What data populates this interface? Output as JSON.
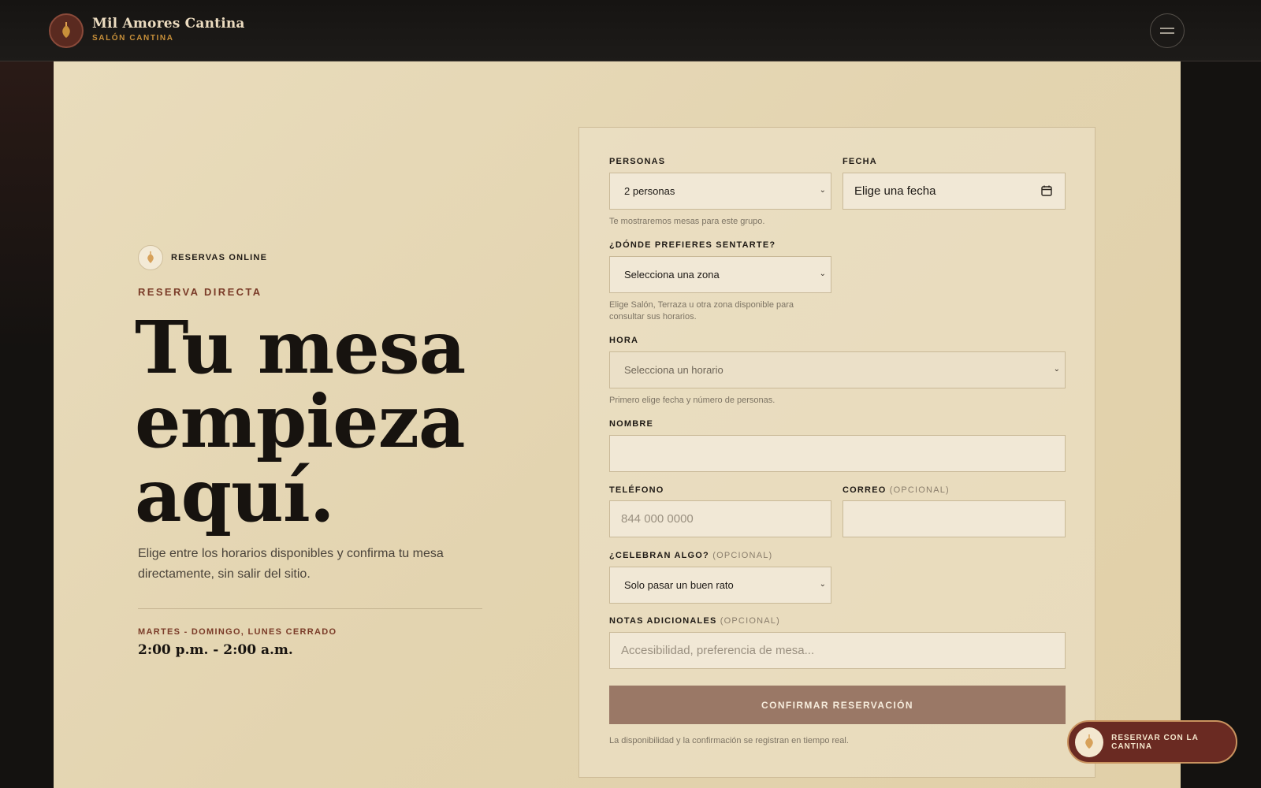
{
  "header": {
    "brand_name": "Mil Amores Cantina",
    "brand_sub": "SALÓN CANTINA",
    "logo_icon": "sacred-heart-icon",
    "menu_icon": "hamburger-menu-icon"
  },
  "hero": {
    "badge_text": "RESERVAS ONLINE",
    "eyebrow": "RESERVA DIRECTA",
    "title_lines": [
      "Tu mesa",
      "empieza",
      "aquí."
    ],
    "description": "Elige entre los horarios disponibles y confirma tu mesa directamente, sin salir del sitio.",
    "hours_label": "MARTES - DOMINGO, LUNES CERRADO",
    "hours_value": "2:00 p.m. - 2:00 a.m."
  },
  "form": {
    "personas": {
      "label": "PERSONAS",
      "value": "2 personas",
      "help": "Te mostraremos mesas para este grupo."
    },
    "fecha": {
      "label": "FECHA",
      "placeholder": "Elige una fecha"
    },
    "zona": {
      "label": "¿DÓNDE PREFIERES SENTARTE?",
      "value": "Selecciona una zona",
      "help": "Elige Salón, Terraza u otra zona disponible para consultar sus horarios."
    },
    "hora": {
      "label": "HORA",
      "value": "Selecciona un horario",
      "help": "Primero elige fecha y número de personas."
    },
    "nombre": {
      "label": "NOMBRE",
      "value": ""
    },
    "telefono": {
      "label": "TELÉFONO",
      "placeholder": "844 000 0000"
    },
    "correo": {
      "label": "CORREO",
      "optional": "(OPCIONAL)",
      "value": ""
    },
    "celebran": {
      "label": "¿CELEBRAN ALGO?",
      "optional": "(OPCIONAL)",
      "value": "Solo pasar un buen rato"
    },
    "notas": {
      "label": "NOTAS ADICIONALES",
      "optional": "(OPCIONAL)",
      "placeholder": "Accesibilidad, preferencia de mesa..."
    },
    "submit_label": "CONFIRMAR RESERVACIÓN",
    "footnote": "La disponibilidad y la confirmación se registran en tiempo real."
  },
  "floating_cta": {
    "label": "RESERVAR CON LA CANTINA"
  },
  "colors": {
    "page_bg": "#e6d8b6",
    "accent": "#7a3b28",
    "button": "#9a7866",
    "topbar": "#161412"
  }
}
